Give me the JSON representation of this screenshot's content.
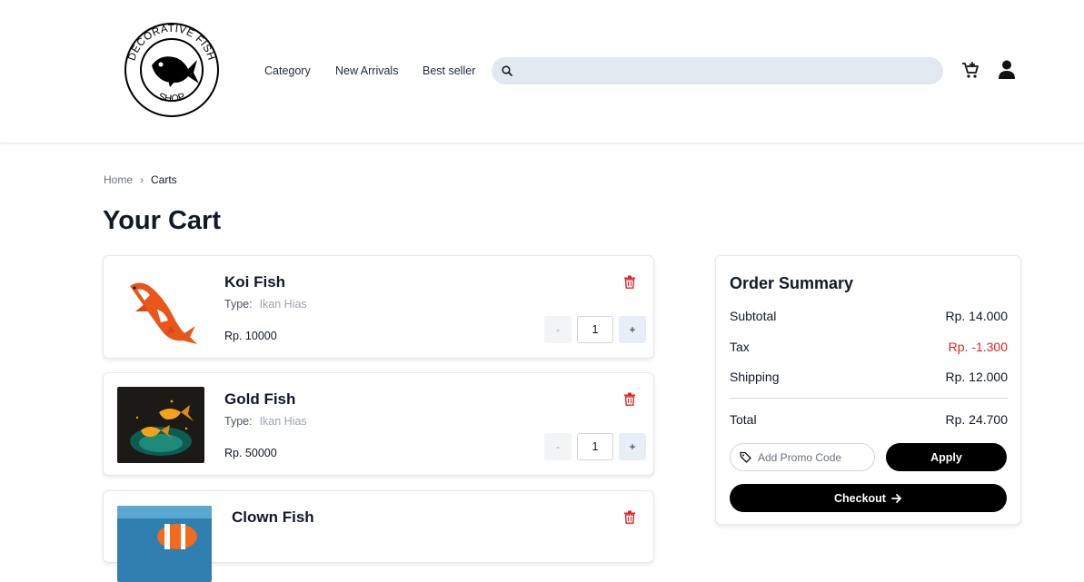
{
  "header": {
    "logo_text": "DECORATIVE FISH SHOP",
    "nav": [
      {
        "label": "Category"
      },
      {
        "label": "New Arrivals"
      },
      {
        "label": "Best seller"
      }
    ],
    "search": {
      "value": "",
      "placeholder": ""
    }
  },
  "breadcrumb": {
    "home": "Home",
    "separator": "›",
    "current": "Carts"
  },
  "page_title": "Your Cart",
  "cart": {
    "type_label": "Type:",
    "items": [
      {
        "name": "Koi Fish",
        "type": "Ikan Hias",
        "price": "Rp. 10000",
        "qty": "1",
        "minus": "-",
        "plus": "+"
      },
      {
        "name": "Gold Fish",
        "type": "Ikan Hias",
        "price": "Rp. 50000",
        "qty": "1",
        "minus": "-",
        "plus": "+"
      },
      {
        "name": "Clown Fish",
        "type": "",
        "price": "",
        "qty": "",
        "minus": "",
        "plus": ""
      }
    ]
  },
  "summary": {
    "title": "Order Summary",
    "rows": [
      {
        "label": "Subtotal",
        "value": "Rp. 14.000"
      },
      {
        "label": "Tax",
        "value": "Rp. -1.300"
      },
      {
        "label": "Shipping",
        "value": "Rp. 12.000"
      }
    ],
    "total_label": "Total",
    "total_value": "Rp. 24.700",
    "promo_placeholder": "Add Promo Code",
    "apply_label": "Apply",
    "checkout_label": "Checkout"
  },
  "colors": {
    "accent": "#000000",
    "negative": "#dc2626",
    "search_bg": "#e2e8f0",
    "trash": "#dc2626"
  },
  "icons": [
    "search-icon",
    "cart-icon",
    "user-icon",
    "trash-icon",
    "tag-icon",
    "arrow-right-icon"
  ]
}
